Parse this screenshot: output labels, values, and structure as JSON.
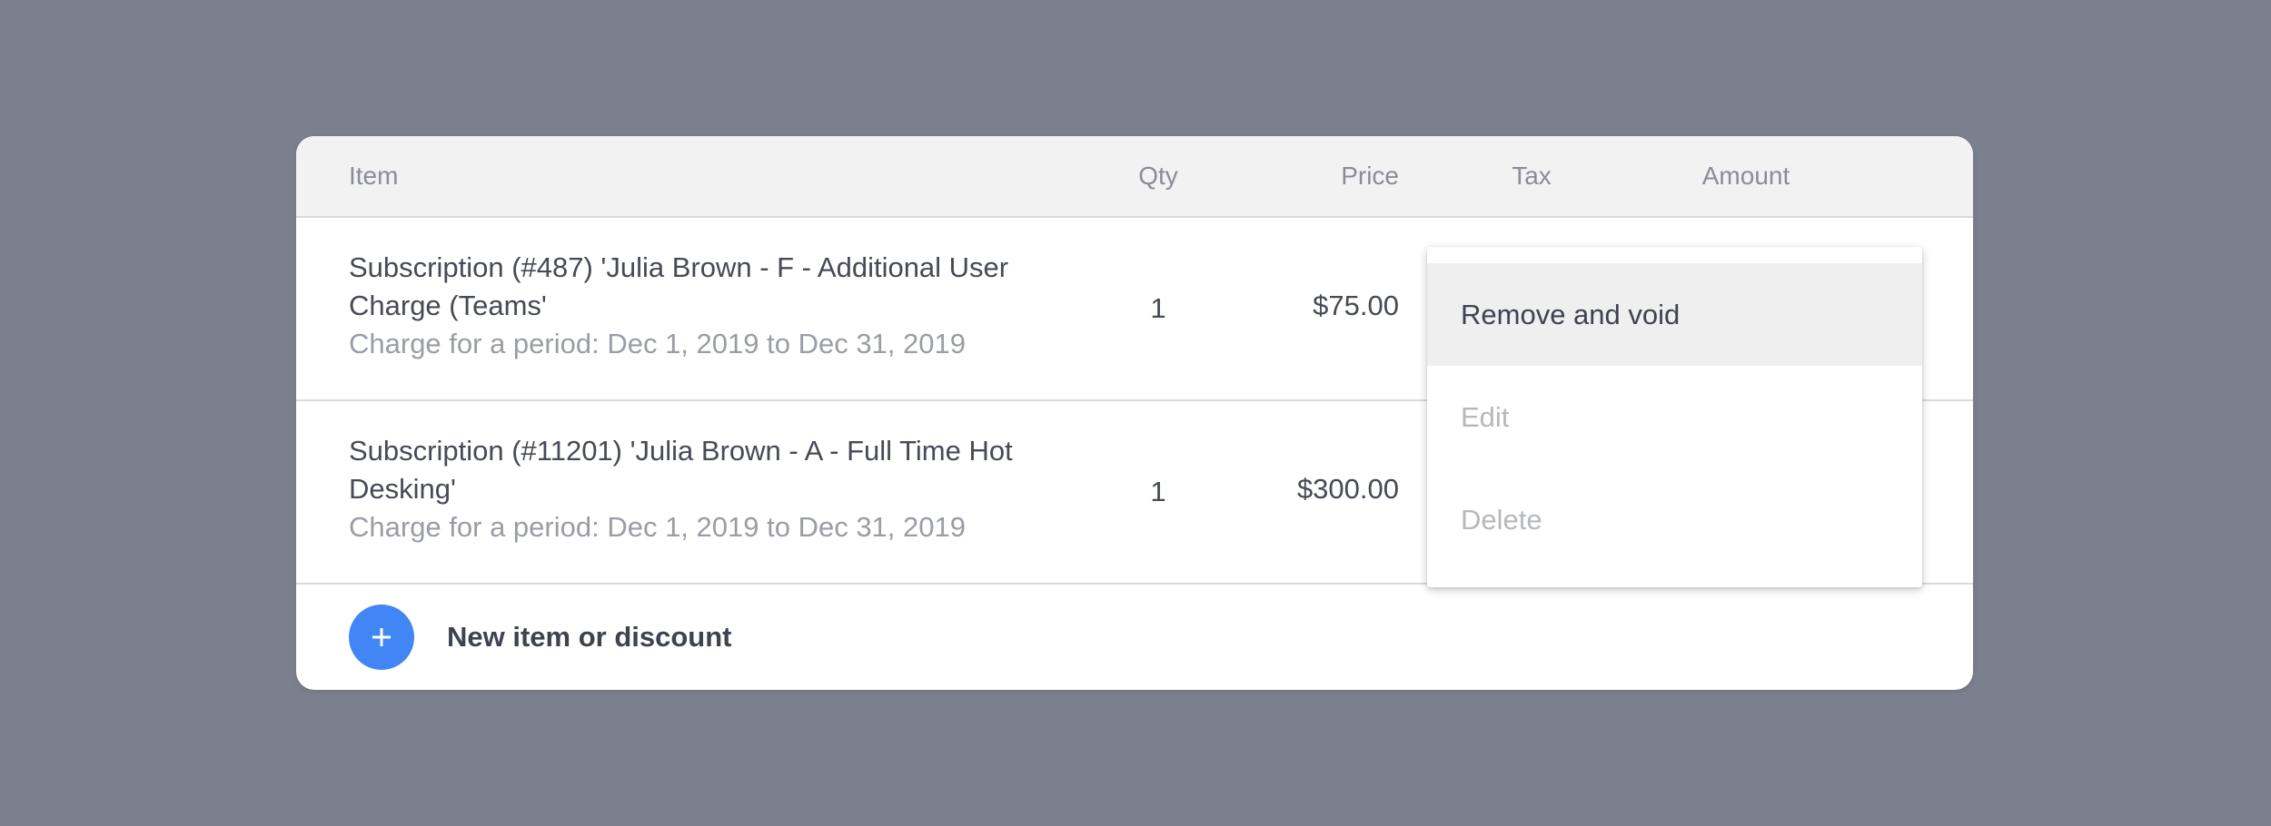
{
  "table": {
    "headers": {
      "item": "Item",
      "qty": "Qty",
      "price": "Price",
      "tax": "Tax",
      "amount": "Amount"
    },
    "rows": [
      {
        "title": "Subscription (#487) 'Julia Brown - F - Additional User Charge (Teams'",
        "period": "Charge for a period: Dec 1, 2019 to Dec 31, 2019",
        "qty": "1",
        "price": "$75.00"
      },
      {
        "title": "Subscription (#11201) 'Julia Brown - A - Full Time Hot Desking'",
        "period": "Charge for a period: Dec 1, 2019 to Dec 31, 2019",
        "qty": "1",
        "price": "$300.00"
      }
    ]
  },
  "footer": {
    "add_label": "New item or discount",
    "add_icon": "plus-icon"
  },
  "context_menu": {
    "items": [
      {
        "label": "Remove and void",
        "state": "hovered"
      },
      {
        "label": "Edit",
        "state": "disabled"
      },
      {
        "label": "Delete",
        "state": "disabled"
      }
    ]
  },
  "colors": {
    "background": "#7b808e",
    "accent": "#4285f4",
    "header_bg": "#f2f2f3",
    "text": "#464a56",
    "muted_text": "#9a9da6"
  }
}
